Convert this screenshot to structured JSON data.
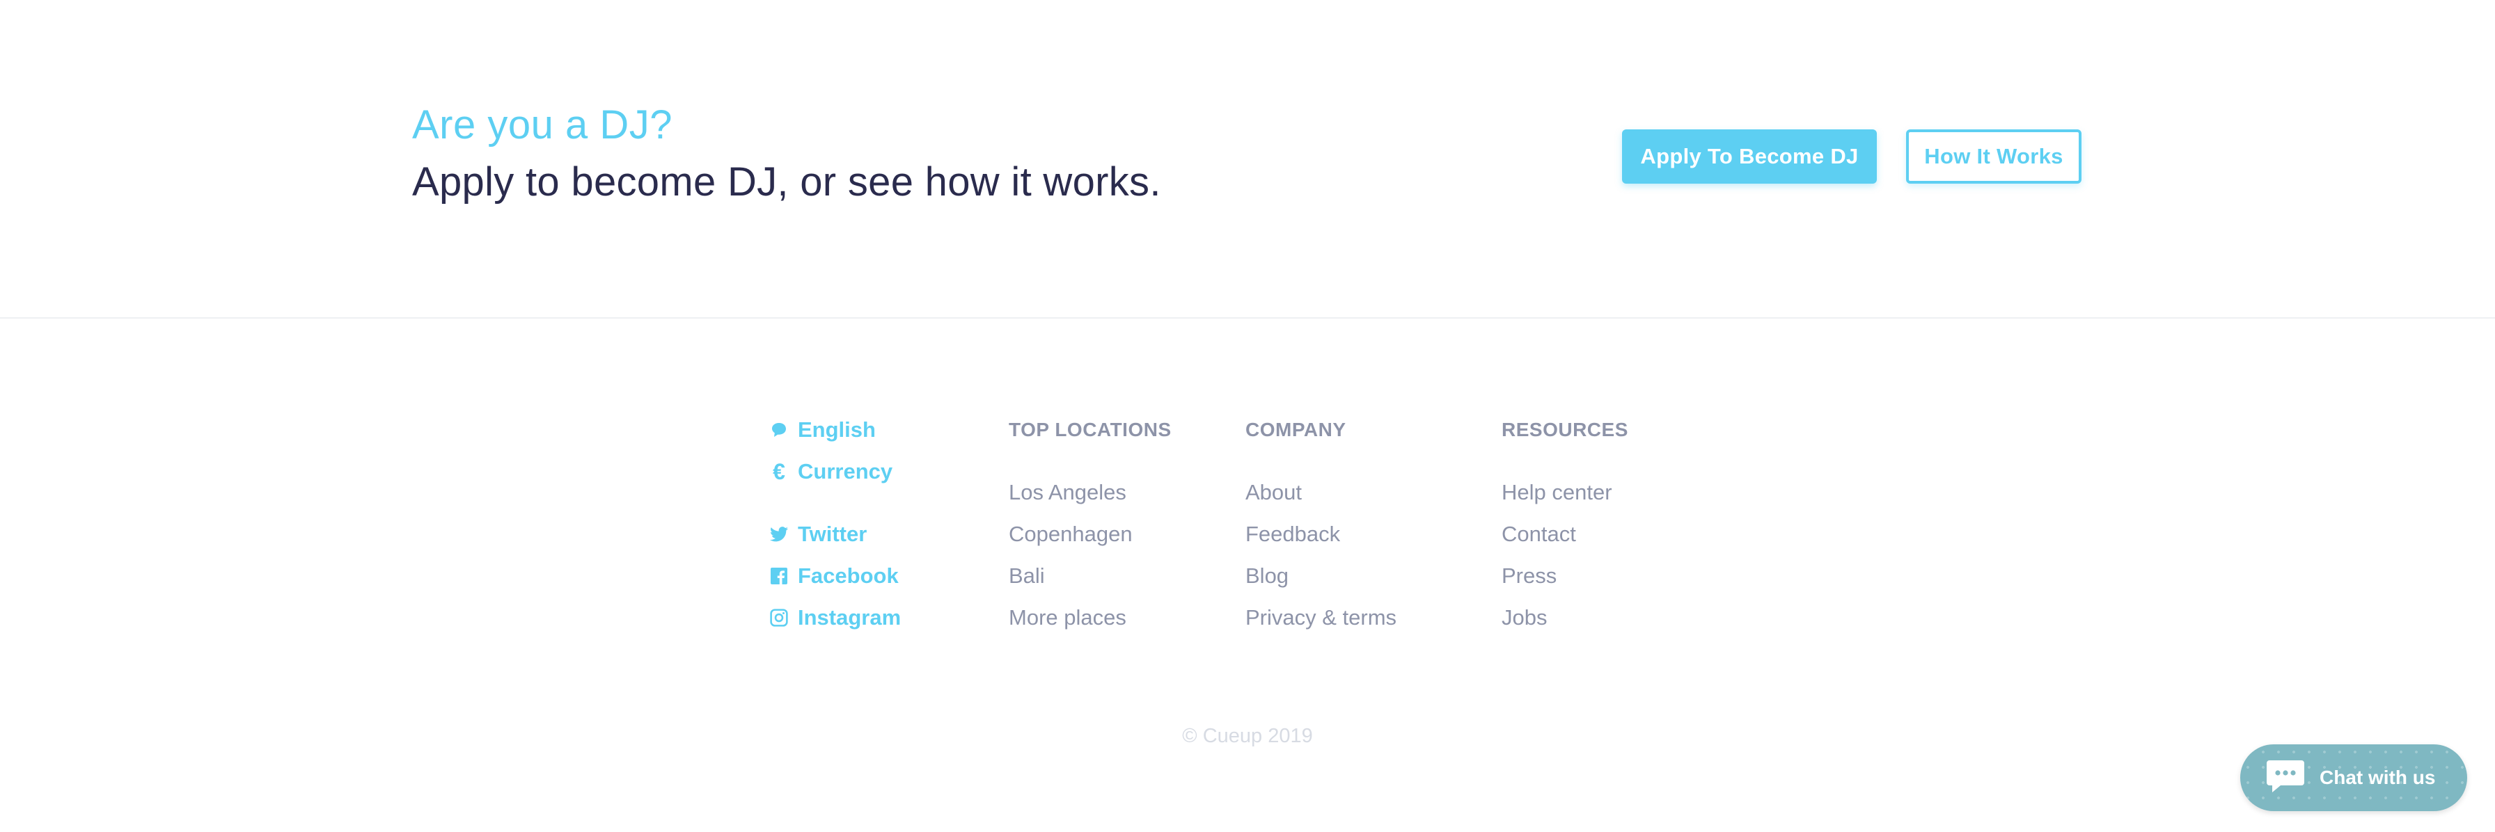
{
  "cta": {
    "question": "Are you a DJ?",
    "subtitle": "Apply to become DJ, or see how it works.",
    "apply_button": "Apply To Become DJ",
    "how_button": "How It Works"
  },
  "footer": {
    "left_links": [
      {
        "label": "English",
        "icon": "speech-bubble-icon"
      },
      {
        "label": "Currency",
        "icon": "euro-icon"
      },
      {
        "label": "Twitter",
        "icon": "twitter-icon"
      },
      {
        "label": "Facebook",
        "icon": "facebook-icon"
      },
      {
        "label": "Instagram",
        "icon": "instagram-icon"
      }
    ],
    "top_locations": {
      "heading": "TOP LOCATIONS",
      "links": [
        "Los Angeles",
        "Copenhagen",
        "Bali",
        "More places"
      ]
    },
    "company": {
      "heading": "COMPANY",
      "links": [
        "About",
        "Feedback",
        "Blog",
        "Privacy & terms"
      ]
    },
    "resources": {
      "heading": "RESOURCES",
      "links": [
        "Help center",
        "Contact",
        "Press",
        "Jobs"
      ]
    },
    "copyright": "© Cueup 2019"
  },
  "chat": {
    "label": "Chat with us",
    "icon": "chat-bubble-icon"
  },
  "colors": {
    "accent": "#5dcff2",
    "heading": "#2a2b4d",
    "muted": "#8d93a8",
    "chat": "#7fb8c2"
  }
}
